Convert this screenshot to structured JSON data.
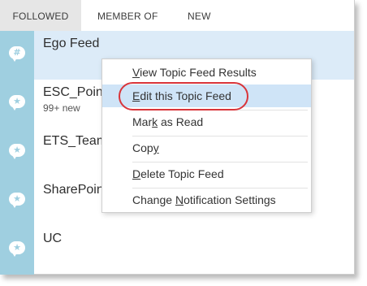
{
  "tabs": [
    {
      "label": "FOLLOWED",
      "active": true
    },
    {
      "label": "MEMBER OF",
      "active": false
    },
    {
      "label": "NEW",
      "active": false
    }
  ],
  "feeds": [
    {
      "name": "Ego Feed",
      "sub": "",
      "icon": "hashtag-chat-icon",
      "selected": true
    },
    {
      "name": "ESC_Poin",
      "sub": "99+ new",
      "icon": "star-chat-icon",
      "selected": false
    },
    {
      "name": "ETS_Team",
      "sub": "",
      "icon": "star-chat-icon",
      "selected": false
    },
    {
      "name": "SharePoin",
      "sub": "",
      "icon": "star-chat-icon",
      "selected": false
    },
    {
      "name": "UC",
      "sub": "",
      "icon": "star-chat-icon",
      "selected": false
    }
  ],
  "context_menu": {
    "items": [
      {
        "label": "View Topic Feed Results",
        "accelerator": "V"
      },
      {
        "label": "Edit this Topic Feed",
        "accelerator": "E",
        "highlighted": true
      },
      {
        "label": "Mark as Read",
        "accelerator": "k"
      },
      {
        "label": "Copy",
        "accelerator": "y"
      },
      {
        "label": "Delete Topic Feed",
        "accelerator": "D"
      },
      {
        "label": "Change Notification Settings",
        "accelerator": "N"
      }
    ]
  },
  "colors": {
    "avatar_bg": "#9fcfe0",
    "selected_row": "#dcebf8",
    "menu_hover": "#cfe4f7",
    "annotation_ring": "#d9353a"
  }
}
